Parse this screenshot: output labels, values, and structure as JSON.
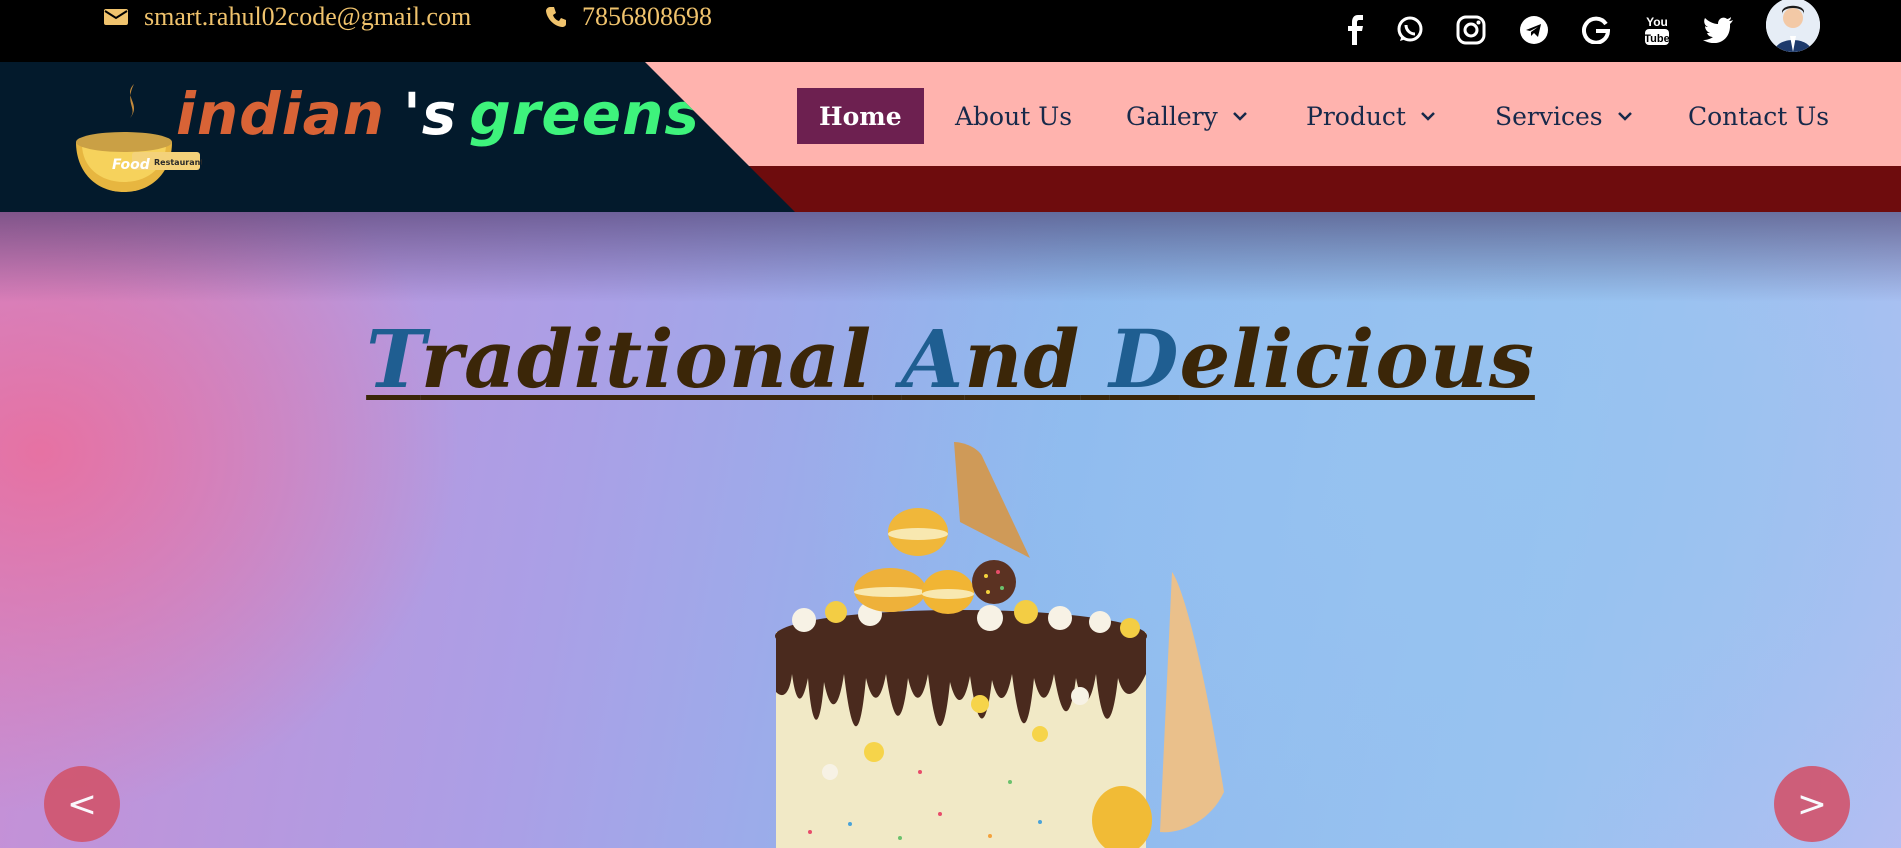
{
  "topbar": {
    "email": "smart.rahul02code@gmail.com",
    "phone": "7856808698",
    "social": [
      "facebook-icon",
      "whatsapp-icon",
      "instagram-icon",
      "telegram-icon",
      "google-icon",
      "youtube-icon",
      "twitter-icon"
    ]
  },
  "brand": {
    "word1": "indian",
    "word2": "'s",
    "word3": "greens",
    "logo_text_1": "Food",
    "logo_text_2": "Restaurant"
  },
  "nav": {
    "home": "Home",
    "about": "About Us",
    "gallery": "Gallery",
    "product": "Product",
    "services": "Services",
    "contact": "Contact Us"
  },
  "hero": {
    "title_parts": {
      "t1_cap": "T",
      "t1_rest": "raditional",
      "t2_cap": "A",
      "t2_rest": "nd",
      "t3_cap": "D",
      "t3_rest": "elicious"
    },
    "prev": "<",
    "next": ">"
  },
  "colors": {
    "topbar_bg": "#000000",
    "contact_text": "#f0c36d",
    "header_pink": "#ffb3ae",
    "header_dark": "#031a2c",
    "header_red_band": "#6e0c0d",
    "nav_active_bg": "#6d2050",
    "brand_orange": "#d86336",
    "brand_green": "#3ef37c",
    "title_brown": "#3b2608",
    "title_blue": "#1f5e91",
    "arrow_bg": "#d1566f"
  }
}
